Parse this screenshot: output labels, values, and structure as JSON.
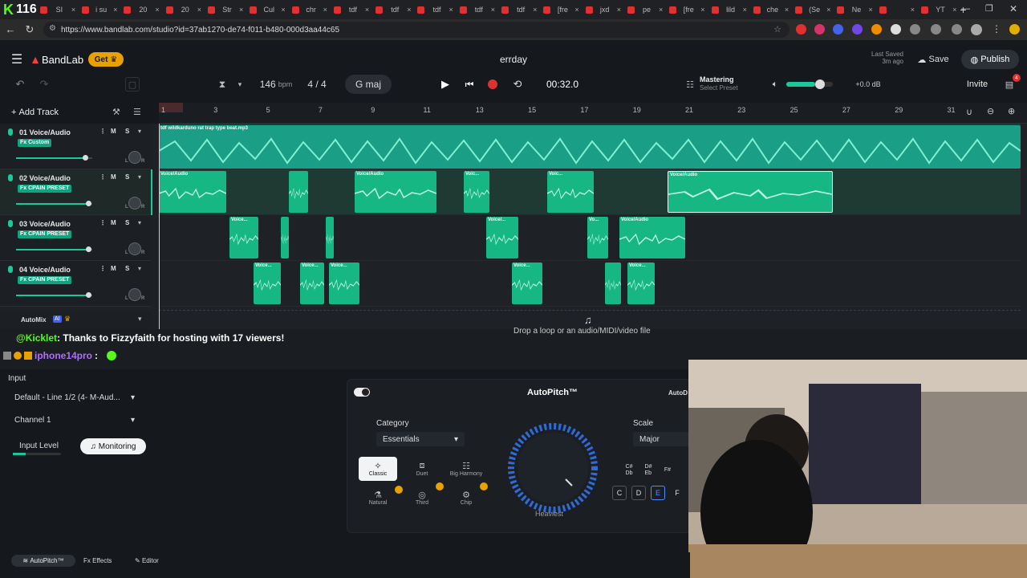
{
  "browser": {
    "kick_counter": "116",
    "tabs": [
      "SI",
      "i su",
      "20",
      "20",
      "Str",
      "Cul",
      "chr",
      "tdf",
      "tdf",
      "tdf",
      "tdf",
      "tdf",
      "[fre",
      "jxd",
      "pe",
      "[fre",
      "lild",
      "che",
      "(Se",
      "Ne",
      "",
      "YT"
    ],
    "url": "https://www.bandlab.com/studio?id=37ab1270-de74-f011-b480-000d3aa44c65"
  },
  "header": {
    "brand": "BandLab",
    "get_label": "Get",
    "project_title": "errday",
    "last_saved_line1": "Last Saved",
    "last_saved_line2": "3m ago",
    "save_label": "Save",
    "publish_label": "Publish",
    "invite_label": "Invite",
    "invite_badge": "4",
    "tempo": "146",
    "tempo_unit": "bpm",
    "time_sig": "4 / 4",
    "key": "G maj",
    "time": "00:32.0",
    "mastering_label": "Mastering",
    "mastering_sub": "Select Preset",
    "volume_db": "+0.0 dB",
    "add_track_label": "Add Track"
  },
  "ruler": [
    "1",
    "3",
    "5",
    "7",
    "9",
    "11",
    "13",
    "15",
    "17",
    "19",
    "21",
    "23",
    "25",
    "27",
    "29",
    "31"
  ],
  "tracks": [
    {
      "name": "01 Voice/Audio",
      "fx": "Fx Custom",
      "volume": 0.9
    },
    {
      "name": "02 Voice/Audio",
      "fx": "Fx CPAIN PRESET",
      "volume": 0.95
    },
    {
      "name": "03 Voice/Audio",
      "fx": "Fx CPAIN PRESET",
      "volume": 0.95
    },
    {
      "name": "04 Voice/Audio",
      "fx": "Fx CPAIN PRESET",
      "volume": 0.95
    }
  ],
  "track_controls": {
    "m": "M",
    "s": "S",
    "l": "L",
    "r": "R"
  },
  "clips": {
    "beat_name": "tdf wildkarduno rat trap type beat.mp3",
    "voice": "Voice/Audio",
    "voice_short": "Voice...",
    "voice_tiny": "Voic...",
    "voice_short2": "Voice/...",
    "voice_tiny2": "Vo..."
  },
  "automix": {
    "label": "AutoMix",
    "ai": "AI"
  },
  "drop_hint": "Drop a loop or an audio/MIDI/video file",
  "chat": {
    "line1_user": "@Kicklet",
    "line1_text": ": Thanks to Fizzyfaith for hosting with 17 viewers!",
    "line2_user": "iphone14pro",
    "line2_text": ":"
  },
  "input_panel": {
    "input_label": "Input",
    "device": "Default - Line 1/2 (4- M-Aud...",
    "channel": "Channel 1",
    "input_level": "Input Level",
    "monitoring": "Monitoring"
  },
  "autopitch": {
    "title": "AutoPitch™",
    "title_right": "AutoD",
    "category_label": "Category",
    "category_value": "Essentials",
    "scale_label": "Scale",
    "scale_value": "Major",
    "presets": [
      "Classic",
      "Duet",
      "Big Harmony",
      "Natural",
      "Third",
      "Chip"
    ],
    "knob_label": "Heaviest",
    "keys_top": [
      "C#\nDb",
      "D#\nEb",
      "F#"
    ],
    "keys_bottom": [
      "C",
      "D",
      "E",
      "F"
    ]
  },
  "footer": {
    "autopitch": "AutoPitch™",
    "effects": "Effects",
    "editor": "Editor"
  },
  "colors": {
    "accent": "#17b784",
    "brand_red": "#f2413a",
    "kick_green": "#53fc18",
    "record": "#e03131"
  }
}
